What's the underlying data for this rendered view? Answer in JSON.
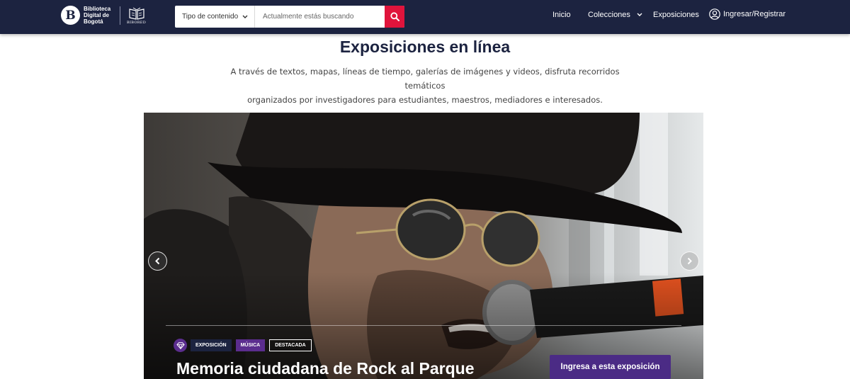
{
  "header": {
    "logo_text": "Biblioteca Digital de Bogotá",
    "logo_initial": "B",
    "partner_label": "BIBORED",
    "search": {
      "type_label": "Tipo de contenido",
      "placeholder": "Actualmente estás buscando"
    },
    "nav": {
      "home": "Inicio",
      "collections": "Colecciones",
      "exhibitions": "Exposiciones",
      "login": "Ingresar/Registrar"
    }
  },
  "main": {
    "title": "Exposiciones en línea",
    "subtitle_line1": "A través de textos, mapas, líneas de tiempo, galerías de imágenes y videos, disfruta recorridos temáticos",
    "subtitle_line2": "organizados por investigadores para estudiantes, maestros, mediadores e interesados."
  },
  "hero": {
    "tags": [
      "EXPOSICIÓN",
      "MÚSICA",
      "DESTACADA"
    ],
    "title": "Memoria ciudadana de Rock al Parque",
    "cta_label": "Ingresa a esta exposición"
  },
  "colors": {
    "navbar": "#1c2340",
    "accent_red": "#e0143c",
    "accent_purple": "#4b2b85",
    "tag_purple": "#5b2d8e"
  },
  "icons": [
    "chevron-down-icon",
    "search-icon",
    "user-icon",
    "arrow-left-icon",
    "arrow-right-icon",
    "gem-icon"
  ]
}
